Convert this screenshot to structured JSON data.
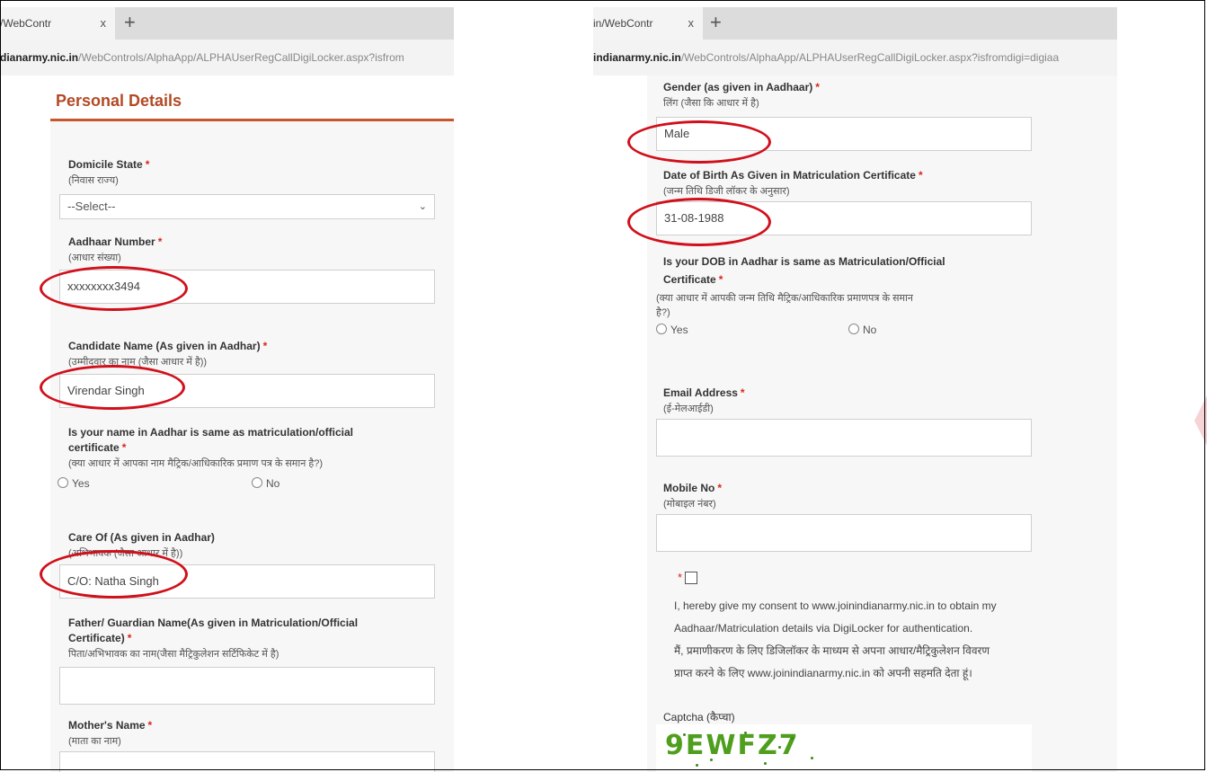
{
  "left": {
    "tab_title": "/WebContr",
    "tab_close": "x",
    "new_tab": "+",
    "url_host": "dianarmy.nic.in",
    "url_path": "/WebControls/AlphaApp/ALPHAUserRegCallDigiLocker.aspx?isfrom",
    "section_title": "Personal Details",
    "domicile": {
      "label": "Domicile State",
      "hindi": "(निवास राज्य)",
      "selected": "--Select--"
    },
    "aadhaar": {
      "label": "Aadhaar Number",
      "hindi": "(आधार संख्या)",
      "value": "xxxxxxxx3494"
    },
    "candidate": {
      "label": "Candidate Name (As given in Aadhar)",
      "hindi": "(उम्मीदवार का नाम (जैसा आधार में है))",
      "value": "Virendar Singh"
    },
    "name_same": {
      "label_line1": "Is your name in Aadhar is same as matriculation/official",
      "label_line2": "certificate",
      "hindi": "(क्या आधार में आपका नाम मैट्रिक/आधिकारिक प्रमाण पत्र के समान है?)",
      "yes": "Yes",
      "no": "No"
    },
    "care_of": {
      "label": "Care Of (As given in Aadhar)",
      "hindi": "(अभिभावक (जैसा आधार में है))",
      "value": "C/O: Natha Singh"
    },
    "father": {
      "label_line1": "Father/ Guardian Name(As given in Matriculation/Official",
      "label_line2": "Certificate)",
      "hindi": "पिता/अभिभावक का नाम(जैसा मैट्रिकुलेशन सर्टिफिकेट में है)",
      "value": ""
    },
    "mother": {
      "label": "Mother's Name",
      "hindi": "(माता का नाम)"
    }
  },
  "right": {
    "tab_title": "in/WebContr",
    "tab_close": "x",
    "new_tab": "+",
    "url_host": "indianarmy.nic.in",
    "url_path": "/WebControls/AlphaApp/ALPHAUserRegCallDigiLocker.aspx?isfromdigi=digiaa",
    "gender": {
      "label": "Gender (as given in Aadhaar)",
      "hindi": "लिंग (जैसा कि आधार में है)",
      "value": "Male"
    },
    "dob": {
      "label": "Date of Birth As Given in Matriculation Certificate",
      "hindi": "(जन्म तिथि डिजी लॉकर के अनुसार)",
      "value": "31-08-1988"
    },
    "dob_same": {
      "label_line1": "Is your DOB in Aadhar is same as Matriculation/Official",
      "label_line2": "Certificate",
      "hindi_line1": "(क्या आधार में आपकी जन्म तिथि मैट्रिक/आधिकारिक प्रमाणपत्र के समान",
      "hindi_line2": "है?)",
      "yes": "Yes",
      "no": "No"
    },
    "email": {
      "label": "Email Address",
      "hindi": "(ई-मेलआईडी)",
      "value": ""
    },
    "mobile": {
      "label": "Mobile No",
      "hindi": "(मोबाइल नंबर)",
      "value": ""
    },
    "consent": {
      "star": "*",
      "line1": "I, hereby give my consent to www.joinindianarmy.nic.in to obtain my",
      "line2": "Aadhaar/Matriculation details via DigiLocker for authentication.",
      "line3": "मैं, प्रमाणीकरण के लिए डिजिलॉकर के माध्यम से अपना आधार/मैट्रिकुलेशन विवरण",
      "line4": "प्राप्त करने के लिए www.joinindianarmy.nic.in को अपनी सहमति देता हूं।"
    },
    "captcha": {
      "label": "Captcha (कैप्चा)",
      "text": "9EWFZ7"
    }
  },
  "required_mark": "*",
  "colors": {
    "required": "#d9261c",
    "annotation_ring": "#d0101b",
    "section_title": "#b34a25",
    "captcha": "#4f9e1e"
  }
}
